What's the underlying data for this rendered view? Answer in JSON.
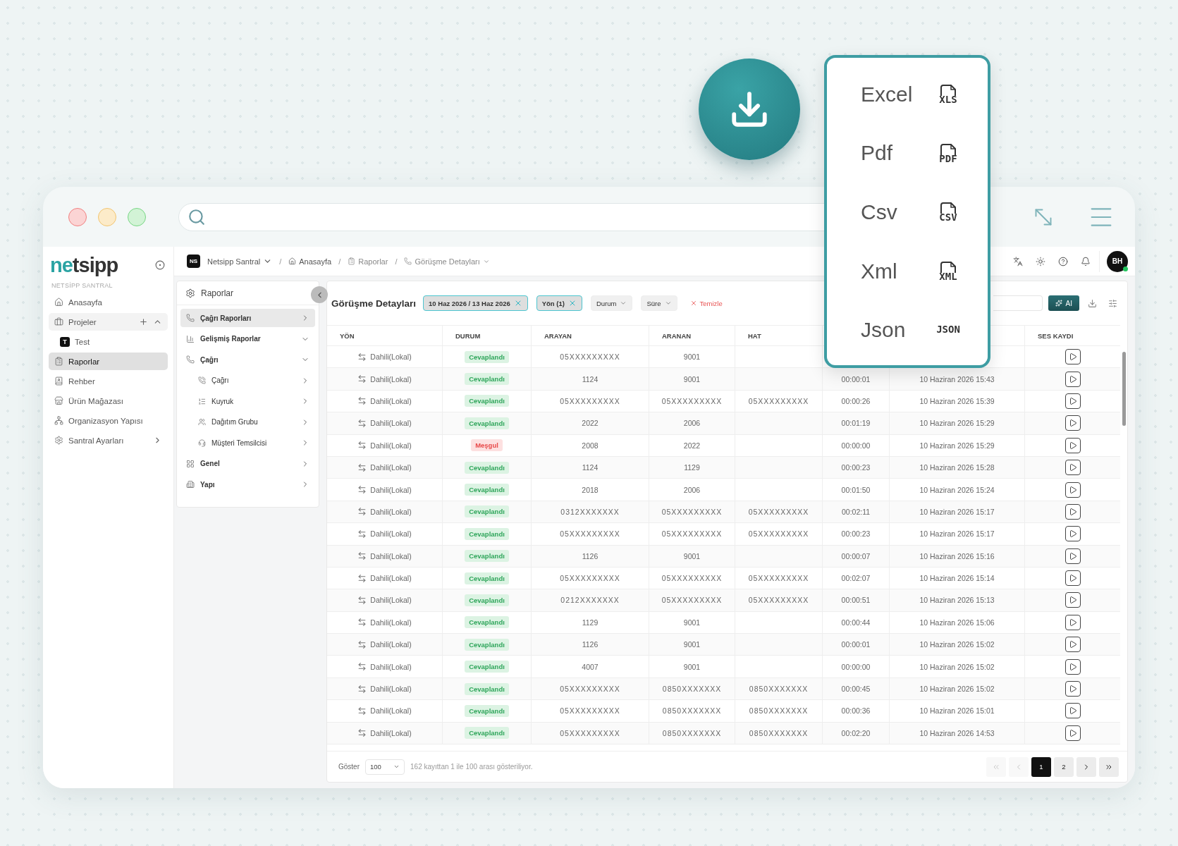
{
  "sidebar": {
    "logo": "netsipp",
    "section": "NETSİPP SANTRAL",
    "items": [
      {
        "label": "Anasayfa",
        "selected": false
      },
      {
        "label": "Projeler",
        "selected": false,
        "expanded": true,
        "children": [
          {
            "label": "Test",
            "badge": "T",
            "selected": false
          }
        ]
      },
      {
        "label": "Raporlar",
        "selected": true
      },
      {
        "label": "Rehber",
        "selected": false
      },
      {
        "label": "Ürün Mağazası",
        "selected": false
      },
      {
        "label": "Organizasyon Yapısı",
        "selected": false
      },
      {
        "label": "Santral Ayarları",
        "selected": false,
        "expanded": false
      }
    ]
  },
  "breadcrumb": {
    "badge": "NS",
    "items": [
      {
        "label": "Netsipp Santral"
      },
      {
        "label": "Anasayfa"
      },
      {
        "label": "Raporlar"
      },
      {
        "label": "Görüşme Detayları"
      }
    ],
    "separator": "/"
  },
  "user": {
    "initials": "BH",
    "online": true
  },
  "submenu": {
    "title": "Raporlar",
    "items": [
      {
        "label": "Çağrı Raporları",
        "selected": true,
        "expanded": false
      },
      {
        "label": "Gelişmiş Raporlar",
        "selected": false,
        "expanded": true
      },
      {
        "label": "Çağrı",
        "selected": false,
        "expanded": true,
        "children": [
          {
            "label": "Çağrı",
            "selected": false,
            "expanded": false
          },
          {
            "label": "Kuyruk",
            "selected": false,
            "expanded": false
          },
          {
            "label": "Dağıtım Grubu",
            "selected": false,
            "expanded": false
          },
          {
            "label": "Müşteri Temsilcisi",
            "selected": false,
            "expanded": false
          }
        ]
      },
      {
        "label": "Genel",
        "selected": false,
        "expanded": false
      },
      {
        "label": "Yapı",
        "selected": false,
        "expanded": false
      }
    ]
  },
  "report": {
    "title": "Görüşme Detayları",
    "filters": [
      {
        "label": "10 Haz 2026 / 13 Haz 2026",
        "active": true
      },
      {
        "label": "Yön (1)",
        "active": true
      },
      {
        "label": "Durum",
        "active": false
      },
      {
        "label": "Süre",
        "active": false
      }
    ],
    "clear": "Temizle",
    "ai_button": "AI",
    "columns": [
      "YÖN",
      "DURUM",
      "ARAYAN",
      "ARANAN",
      "HAT",
      "SES KAYDI"
    ],
    "rows": [
      {
        "direction": "Dahili(Lokal)",
        "status": {
          "label": "Cevaplandı",
          "kind": "answered"
        },
        "caller": "05XXXXXXXXX",
        "callee": "9001"
      },
      {
        "direction": "Dahili(Lokal)",
        "status": {
          "label": "Cevaplandı",
          "kind": "answered"
        },
        "caller": "1124",
        "callee": "9001",
        "duration": "00:00:01",
        "date": "10 Haziran 2026 15:43"
      },
      {
        "direction": "Dahili(Lokal)",
        "status": {
          "label": "Cevaplandı",
          "kind": "answered"
        },
        "caller": "05XXXXXXXXX",
        "callee": "05XXXXXXXXX",
        "line": "05XXXXXXXXX",
        "duration": "00:00:26",
        "date": "10 Haziran 2026 15:39"
      },
      {
        "direction": "Dahili(Lokal)",
        "status": {
          "label": "Cevaplandı",
          "kind": "answered"
        },
        "caller": "2022",
        "callee": "2006",
        "duration": "00:01:19",
        "date": "10 Haziran 2026 15:29"
      },
      {
        "direction": "Dahili(Lokal)",
        "status": {
          "label": "Meşgul",
          "kind": "busy"
        },
        "caller": "2008",
        "callee": "2022",
        "duration": "00:00:00",
        "date": "10 Haziran 2026 15:29"
      },
      {
        "direction": "Dahili(Lokal)",
        "status": {
          "label": "Cevaplandı",
          "kind": "answered"
        },
        "caller": "1124",
        "callee": "1129",
        "duration": "00:00:23",
        "date": "10 Haziran 2026 15:28"
      },
      {
        "direction": "Dahili(Lokal)",
        "status": {
          "label": "Cevaplandı",
          "kind": "answered"
        },
        "caller": "2018",
        "callee": "2006",
        "duration": "00:01:50",
        "date": "10 Haziran 2026 15:24"
      },
      {
        "direction": "Dahili(Lokal)",
        "status": {
          "label": "Cevaplandı",
          "kind": "answered"
        },
        "caller": "0312XXXXXXX",
        "callee": "05XXXXXXXXX",
        "line": "05XXXXXXXXX",
        "duration": "00:02:11",
        "date": "10 Haziran 2026 15:17"
      },
      {
        "direction": "Dahili(Lokal)",
        "status": {
          "label": "Cevaplandı",
          "kind": "answered"
        },
        "caller": "05XXXXXXXXX",
        "callee": "05XXXXXXXXX",
        "line": "05XXXXXXXXX",
        "duration": "00:00:23",
        "date": "10 Haziran 2026 15:17"
      },
      {
        "direction": "Dahili(Lokal)",
        "status": {
          "label": "Cevaplandı",
          "kind": "answered"
        },
        "caller": "1126",
        "callee": "9001",
        "duration": "00:00:07",
        "date": "10 Haziran 2026 15:16"
      },
      {
        "direction": "Dahili(Lokal)",
        "status": {
          "label": "Cevaplandı",
          "kind": "answered"
        },
        "caller": "05XXXXXXXXX",
        "callee": "05XXXXXXXXX",
        "line": "05XXXXXXXXX",
        "duration": "00:02:07",
        "date": "10 Haziran 2026 15:14"
      },
      {
        "direction": "Dahili(Lokal)",
        "status": {
          "label": "Cevaplandı",
          "kind": "answered"
        },
        "caller": "0212XXXXXXX",
        "callee": "05XXXXXXXXX",
        "line": "05XXXXXXXXX",
        "duration": "00:00:51",
        "date": "10 Haziran 2026 15:13"
      },
      {
        "direction": "Dahili(Lokal)",
        "status": {
          "label": "Cevaplandı",
          "kind": "answered"
        },
        "caller": "1129",
        "callee": "9001",
        "duration": "00:00:44",
        "date": "10 Haziran 2026 15:06"
      },
      {
        "direction": "Dahili(Lokal)",
        "status": {
          "label": "Cevaplandı",
          "kind": "answered"
        },
        "caller": "1126",
        "callee": "9001",
        "duration": "00:00:01",
        "date": "10 Haziran 2026 15:02"
      },
      {
        "direction": "Dahili(Lokal)",
        "status": {
          "label": "Cevaplandı",
          "kind": "answered"
        },
        "caller": "4007",
        "callee": "9001",
        "duration": "00:00:00",
        "date": "10 Haziran 2026 15:02"
      },
      {
        "direction": "Dahili(Lokal)",
        "status": {
          "label": "Cevaplandı",
          "kind": "answered"
        },
        "caller": "05XXXXXXXXX",
        "callee": "0850XXXXXXX",
        "line": "0850XXXXXXX",
        "duration": "00:00:45",
        "date": "10 Haziran 2026 15:02"
      },
      {
        "direction": "Dahili(Lokal)",
        "status": {
          "label": "Cevaplandı",
          "kind": "answered"
        },
        "caller": "05XXXXXXXXX",
        "callee": "0850XXXXXXX",
        "line": "0850XXXXXXX",
        "duration": "00:00:36",
        "date": "10 Haziran 2026 15:01"
      },
      {
        "direction": "Dahili(Lokal)",
        "status": {
          "label": "Cevaplandı",
          "kind": "answered"
        },
        "caller": "05XXXXXXXXX",
        "callee": "0850XXXXXXX",
        "line": "0850XXXXXXX",
        "duration": "00:02:20",
        "date": "10 Haziran 2026 14:53"
      }
    ],
    "pagination": {
      "show_label": "Göster",
      "page_size": "100",
      "summary": "162 kayıttan 1 ile 100 arası gösteriliyor.",
      "nav": [
        {
          "kind": "first",
          "disabled": true
        },
        {
          "kind": "prev",
          "disabled": true
        },
        {
          "kind": "next",
          "disabled": false
        },
        {
          "kind": "last",
          "disabled": false
        }
      ],
      "pages": [
        {
          "label": "1",
          "selected": true
        },
        {
          "label": "2",
          "selected": false
        }
      ]
    }
  },
  "export_menu": {
    "options": [
      {
        "label": "Excel",
        "tag": "XLS"
      },
      {
        "label": "Pdf",
        "tag": "PDF"
      },
      {
        "label": "Csv",
        "tag": "CSV"
      },
      {
        "label": "Xml",
        "tag": "XML"
      },
      {
        "label": "Json",
        "tag": "JSON"
      }
    ]
  }
}
